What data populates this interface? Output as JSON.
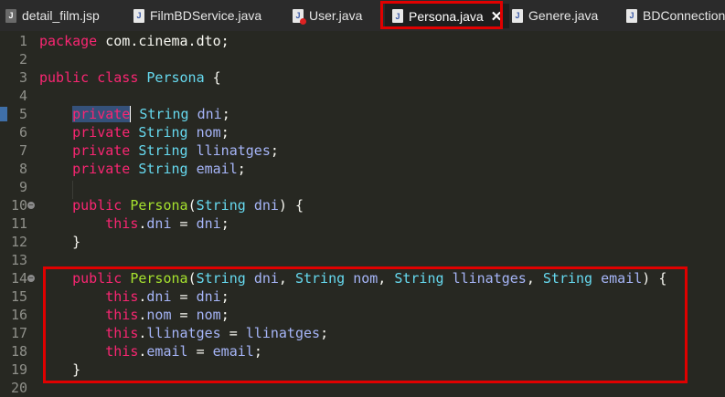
{
  "tabs": [
    {
      "label": "detail_film.jsp",
      "icon": "jsp-file-icon",
      "active": false
    },
    {
      "label": "FilmBDService.java",
      "icon": "java-file-icon",
      "active": false
    },
    {
      "label": "User.java",
      "icon": "java-file-error-icon",
      "active": false
    },
    {
      "label": "Persona.java",
      "icon": "java-file-icon",
      "active": true,
      "close": "✕"
    },
    {
      "label": "Genere.java",
      "icon": "java-file-icon",
      "active": false
    },
    {
      "label": "BDConnection",
      "icon": "java-file-icon",
      "active": false
    }
  ],
  "code": {
    "line_numbers": [
      "1",
      "2",
      "3",
      "4",
      "5",
      "6",
      "7",
      "8",
      "9",
      "10",
      "11",
      "12",
      "13",
      "14",
      "15",
      "16",
      "17",
      "18",
      "19",
      "20"
    ],
    "tokens": {
      "package": "package",
      "package_name": " com.cinema.dto;",
      "public": "public",
      "class": "class",
      "class_name": "Persona",
      "brace_open": " {",
      "brace_close": "}",
      "private": "private",
      "String": "String",
      "dni": "dni",
      "nom": "nom",
      "llinatges": "llinatges",
      "email": "email",
      "semi": ";",
      "this": "this",
      "eq": " = ",
      "paren_open": "(",
      "paren_close_brace": ") {",
      "comma": ", "
    }
  },
  "colors": {
    "keyword": "#f92672",
    "type": "#66d9ef",
    "method": "#a6e22e",
    "field": "#a6b5f8",
    "highlight_box": "#e00000"
  }
}
